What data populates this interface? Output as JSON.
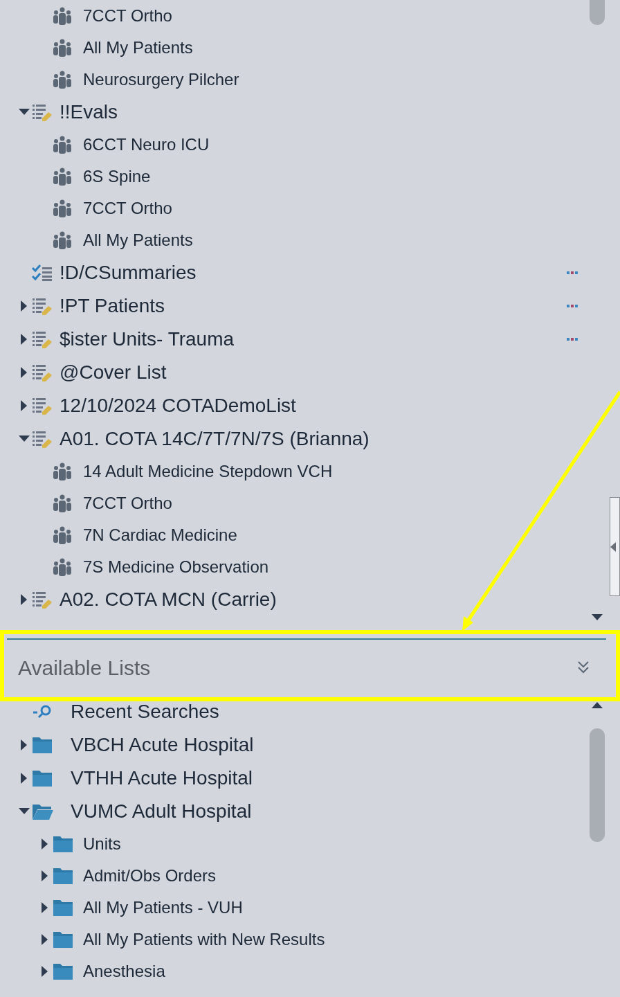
{
  "patient_lists": {
    "leading_children": [
      {
        "kind": "patient_list",
        "label": "7CCT Ortho"
      },
      {
        "kind": "patient_list",
        "label": "All My Patients"
      },
      {
        "kind": "patient_list",
        "label": "Neurosurgery Pilcher"
      }
    ],
    "items": [
      {
        "kind": "list",
        "label": "!!Evals",
        "expanded": true,
        "children": [
          {
            "kind": "patient_list",
            "label": "6CCT Neuro ICU"
          },
          {
            "kind": "patient_list",
            "label": "6S Spine"
          },
          {
            "kind": "patient_list",
            "label": "7CCT Ortho"
          },
          {
            "kind": "patient_list",
            "label": "All My Patients"
          }
        ]
      },
      {
        "kind": "checklist",
        "label": "!D/CSummaries",
        "menu": true
      },
      {
        "kind": "list",
        "label": "!PT Patients",
        "expanded": false,
        "menu": true
      },
      {
        "kind": "list",
        "label": "$ister Units- Trauma",
        "expanded": false,
        "menu": true
      },
      {
        "kind": "list",
        "label": "@Cover List",
        "expanded": false
      },
      {
        "kind": "list",
        "label": "12/10/2024 COTADemoList",
        "expanded": false
      },
      {
        "kind": "list",
        "label": "A01. COTA 14C/7T/7N/7S (Brianna)",
        "expanded": true,
        "children": [
          {
            "kind": "patient_list",
            "label": "14 Adult Medicine Stepdown VCH"
          },
          {
            "kind": "patient_list",
            "label": "7CCT Ortho"
          },
          {
            "kind": "patient_list",
            "label": "7N Cardiac Medicine"
          },
          {
            "kind": "patient_list",
            "label": "7S Medicine Observation"
          }
        ]
      },
      {
        "kind": "list",
        "label": "A02. COTA MCN (Carrie)",
        "expanded": false
      }
    ]
  },
  "available_lists": {
    "title": "Available Lists",
    "items": [
      {
        "kind": "search",
        "label": "Recent Searches"
      },
      {
        "kind": "folder",
        "label": "VBCH Acute Hospital",
        "expanded": false
      },
      {
        "kind": "folder",
        "label": "VTHH Acute Hospital",
        "expanded": false
      },
      {
        "kind": "folder",
        "label": "VUMC Adult Hospital",
        "expanded": true,
        "children": [
          {
            "kind": "folder",
            "label": "Units",
            "expanded": false
          },
          {
            "kind": "folder",
            "label": "Admit/Obs Orders",
            "expanded": false
          },
          {
            "kind": "folder",
            "label": "All My Patients - VUH",
            "expanded": false
          },
          {
            "kind": "folder",
            "label": "All My Patients with New Results",
            "expanded": false
          },
          {
            "kind": "folder",
            "label": "Anesthesia",
            "expanded": false
          }
        ]
      }
    ]
  }
}
